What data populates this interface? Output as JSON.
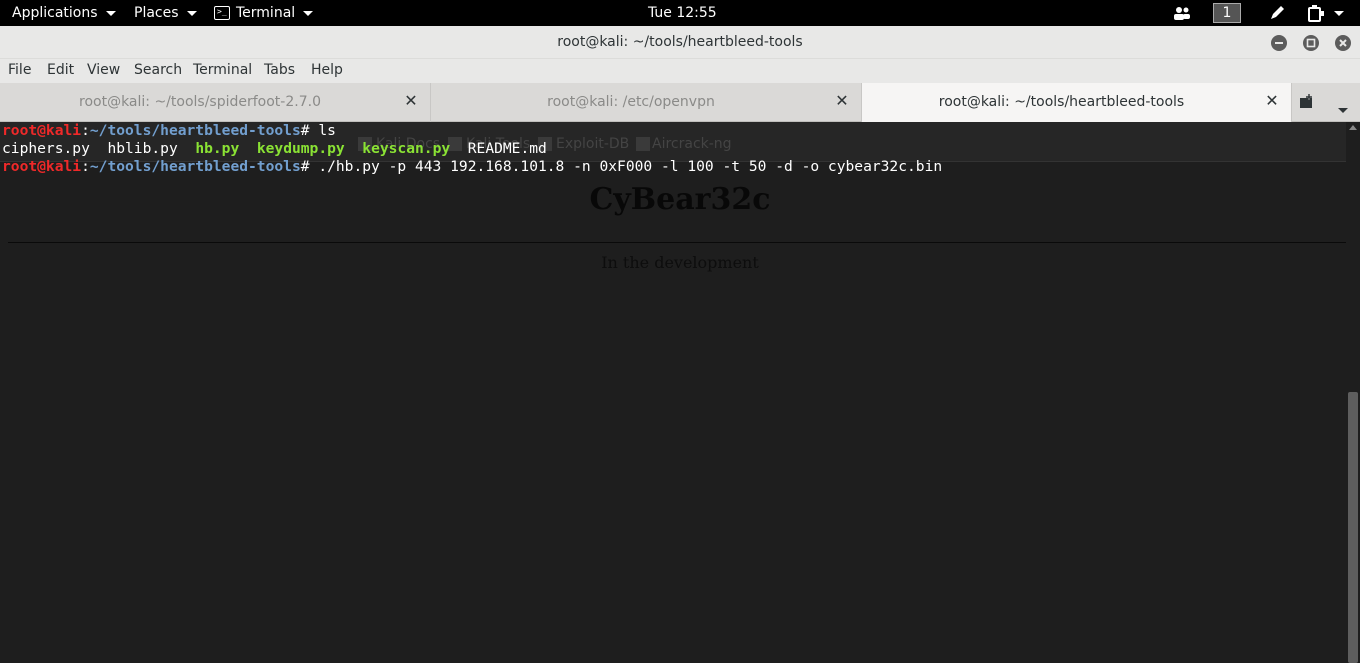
{
  "topbar": {
    "applications": "Applications",
    "places": "Places",
    "terminal": "Terminal",
    "clock": "Tue 12:55",
    "workspace": "1"
  },
  "window": {
    "title": "root@kali: ~/tools/heartbleed-tools"
  },
  "menu": [
    "File",
    "Edit",
    "View",
    "Search",
    "Terminal",
    "Tabs",
    "Help"
  ],
  "tabs": [
    {
      "label": "root@kali: ~/tools/spiderfoot-2.7.0"
    },
    {
      "label": "root@kali: /etc/openvpn"
    },
    {
      "label": "root@kali: ~/tools/heartbleed-tools"
    }
  ],
  "terminal": {
    "prompt_user": "root@kali",
    "prompt_path": "~/tools/heartbleed-tools",
    "cmd1": "ls",
    "files": [
      "ciphers.py",
      "hblib.py",
      "hb.py",
      "keydump.py",
      "keyscan.py",
      "README.md"
    ],
    "cmd2": "./hb.py -p 443 192.168.101.8 -n 0xF000 -l 100 -t 50 -d -o cybear32c.bin"
  },
  "ghost": {
    "bookmarks": [
      "Kali Docs",
      "Kali Tools",
      "Exploit-DB",
      "Aircrack-ng"
    ],
    "heading": "CyBear32c",
    "subtitle": "In the development"
  }
}
